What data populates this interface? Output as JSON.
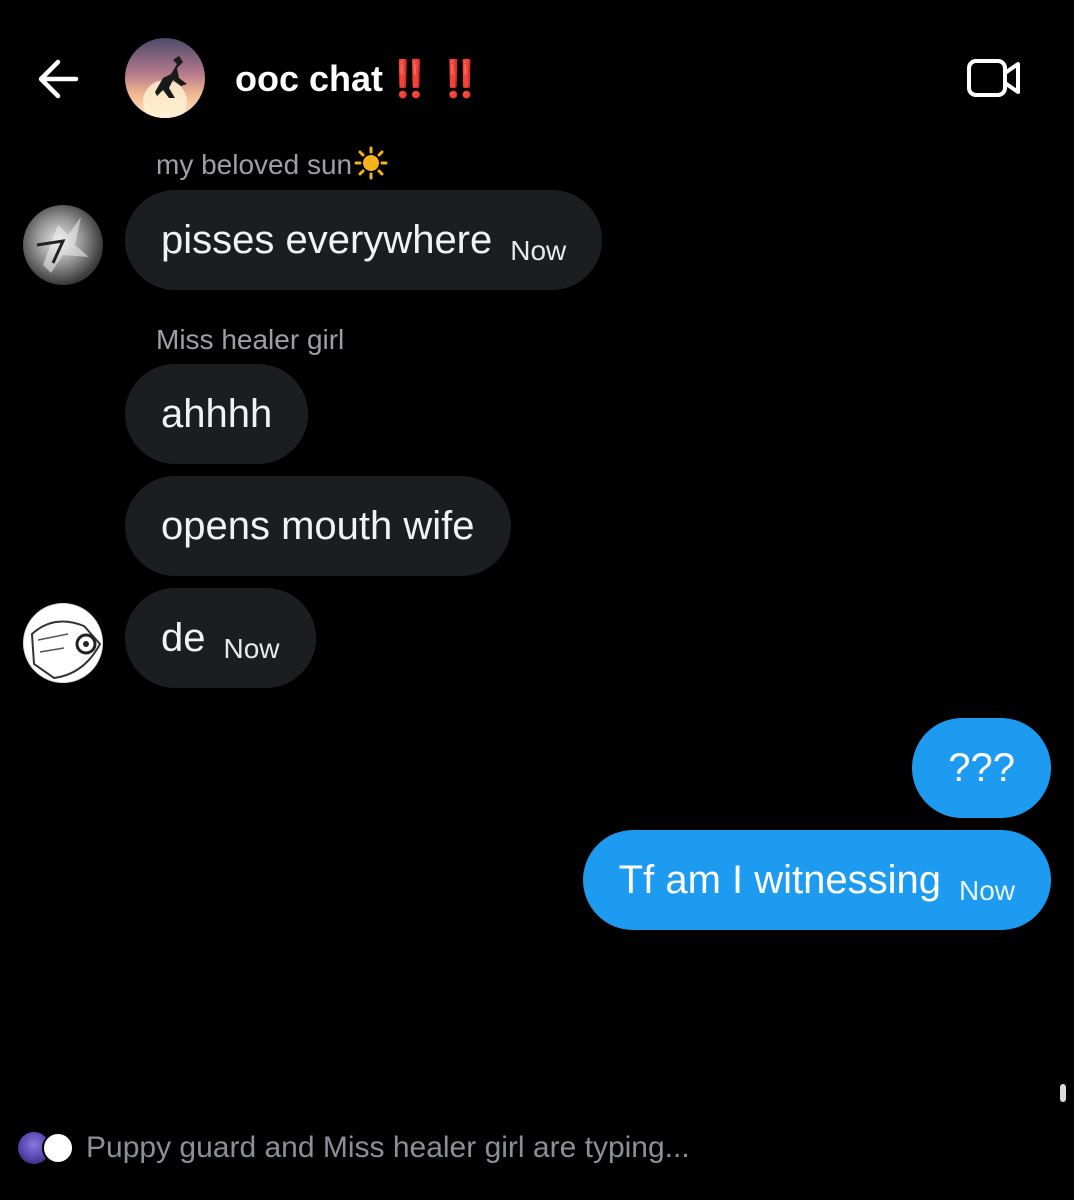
{
  "header": {
    "title": "ooc chat",
    "title_emoji": "‼️ ‼️",
    "back_icon": "arrow-left-icon",
    "video_icon": "video-camera-icon"
  },
  "messages": [
    {
      "sender": "my beloved sun",
      "sender_emoji": "sun-icon",
      "text": "pisses everywhere",
      "time": "Now",
      "direction": "incoming"
    },
    {
      "sender": "Miss healer girl",
      "text": "ahhhh",
      "direction": "incoming"
    },
    {
      "text": "opens mouth wife",
      "direction": "incoming"
    },
    {
      "text": "de",
      "time": "Now",
      "direction": "incoming"
    },
    {
      "text": "???",
      "direction": "outgoing"
    },
    {
      "text": "Tf am I witnessing",
      "time": "Now",
      "direction": "outgoing"
    }
  ],
  "typing": {
    "text": "Puppy guard and Miss healer girl are typing..."
  },
  "colors": {
    "background": "#000000",
    "incoming_bubble": "#1c1d1f",
    "outgoing_bubble": "#1d9bf0",
    "muted_text": "#9aa0a6",
    "alert_red": "#e2202f"
  }
}
